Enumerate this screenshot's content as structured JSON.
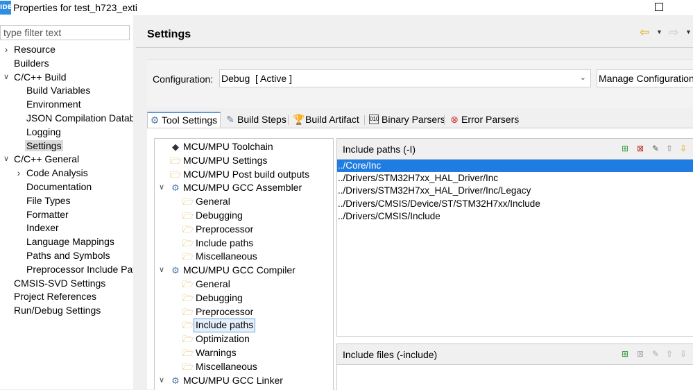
{
  "window": {
    "app_icon": "IDE",
    "title": "Properties for test_h723_exti"
  },
  "filter": {
    "placeholder": "type filter text"
  },
  "nav": {
    "items": [
      {
        "label": "Resource",
        "level": 0,
        "twisty": "closed"
      },
      {
        "label": "Builders",
        "level": 0,
        "twisty": "none"
      },
      {
        "label": "C/C++ Build",
        "level": 0,
        "twisty": "open"
      },
      {
        "label": "Build Variables",
        "level": 1,
        "twisty": "none"
      },
      {
        "label": "Environment",
        "level": 1,
        "twisty": "none"
      },
      {
        "label": "JSON Compilation Datab",
        "level": 1,
        "twisty": "none"
      },
      {
        "label": "Logging",
        "level": 1,
        "twisty": "none"
      },
      {
        "label": "Settings",
        "level": 1,
        "twisty": "none",
        "selected": true
      },
      {
        "label": "C/C++ General",
        "level": 0,
        "twisty": "open"
      },
      {
        "label": "Code Analysis",
        "level": 1,
        "twisty": "closed"
      },
      {
        "label": "Documentation",
        "level": 1,
        "twisty": "none"
      },
      {
        "label": "File Types",
        "level": 1,
        "twisty": "none"
      },
      {
        "label": "Formatter",
        "level": 1,
        "twisty": "none"
      },
      {
        "label": "Indexer",
        "level": 1,
        "twisty": "none"
      },
      {
        "label": "Language Mappings",
        "level": 1,
        "twisty": "none"
      },
      {
        "label": "Paths and Symbols",
        "level": 1,
        "twisty": "none"
      },
      {
        "label": "Preprocessor Include Patl",
        "level": 1,
        "twisty": "none"
      },
      {
        "label": "CMSIS-SVD Settings",
        "level": 0,
        "twisty": "none"
      },
      {
        "label": "Project References",
        "level": 0,
        "twisty": "none"
      },
      {
        "label": "Run/Debug Settings",
        "level": 0,
        "twisty": "none"
      }
    ]
  },
  "header": {
    "title": "Settings",
    "back_icon": "back-arrow-icon",
    "forward_icon": "forward-arrow-icon"
  },
  "configuration": {
    "label": "Configuration:",
    "value": "Debug  [ Active ]",
    "manage_button": "Manage Configuration"
  },
  "tabs": [
    {
      "label": "Tool Settings",
      "icon": "tool-settings-icon",
      "active": true
    },
    {
      "label": "Build Steps",
      "icon": "build-steps-icon"
    },
    {
      "label": "Build Artifact",
      "icon": "trophy-icon"
    },
    {
      "label": "Binary Parsers",
      "icon": "binary-icon"
    },
    {
      "label": "Error Parsers",
      "icon": "error-icon"
    }
  ],
  "tool_tree": [
    {
      "label": "MCU/MPU Toolchain",
      "level": 0,
      "icon": "chip-icon"
    },
    {
      "label": "MCU/MPU Settings",
      "level": 0,
      "icon": "folder-icon"
    },
    {
      "label": "MCU/MPU Post build outputs",
      "level": 0,
      "icon": "folder-icon"
    },
    {
      "label": "MCU/MPU GCC Assembler",
      "level": 0,
      "icon": "gear-icon",
      "twisty": "open"
    },
    {
      "label": "General",
      "level": 1,
      "icon": "folder-icon"
    },
    {
      "label": "Debugging",
      "level": 1,
      "icon": "folder-icon"
    },
    {
      "label": "Preprocessor",
      "level": 1,
      "icon": "folder-icon"
    },
    {
      "label": "Include paths",
      "level": 1,
      "icon": "folder-icon"
    },
    {
      "label": "Miscellaneous",
      "level": 1,
      "icon": "folder-icon"
    },
    {
      "label": "MCU/MPU GCC Compiler",
      "level": 0,
      "icon": "gear-icon",
      "twisty": "open"
    },
    {
      "label": "General",
      "level": 1,
      "icon": "folder-icon"
    },
    {
      "label": "Debugging",
      "level": 1,
      "icon": "folder-icon"
    },
    {
      "label": "Preprocessor",
      "level": 1,
      "icon": "folder-icon"
    },
    {
      "label": "Include paths",
      "level": 1,
      "icon": "folder-icon",
      "selected": true
    },
    {
      "label": "Optimization",
      "level": 1,
      "icon": "folder-icon"
    },
    {
      "label": "Warnings",
      "level": 1,
      "icon": "folder-icon"
    },
    {
      "label": "Miscellaneous",
      "level": 1,
      "icon": "folder-icon"
    },
    {
      "label": "MCU/MPU GCC Linker",
      "level": 0,
      "icon": "gear-icon",
      "twisty": "open"
    }
  ],
  "include_paths": {
    "header": "Include paths (-I)",
    "items": [
      "../Core/Inc",
      "../Drivers/STM32H7xx_HAL_Driver/Inc",
      "../Drivers/STM32H7xx_HAL_Driver/Inc/Legacy",
      "../Drivers/CMSIS/Device/ST/STM32H7xx/Include",
      "../Drivers/CMSIS/Include"
    ],
    "selected_index": 0
  },
  "include_files": {
    "header": "Include files (-include)",
    "items": []
  },
  "list_tools": [
    "add-icon",
    "delete-icon",
    "edit-icon",
    "move-up-icon",
    "move-down-icon"
  ],
  "colors": {
    "selection": "#1f7ce0",
    "accent_tab": "#5f9ad6",
    "back_arrow": "#e0a800"
  }
}
